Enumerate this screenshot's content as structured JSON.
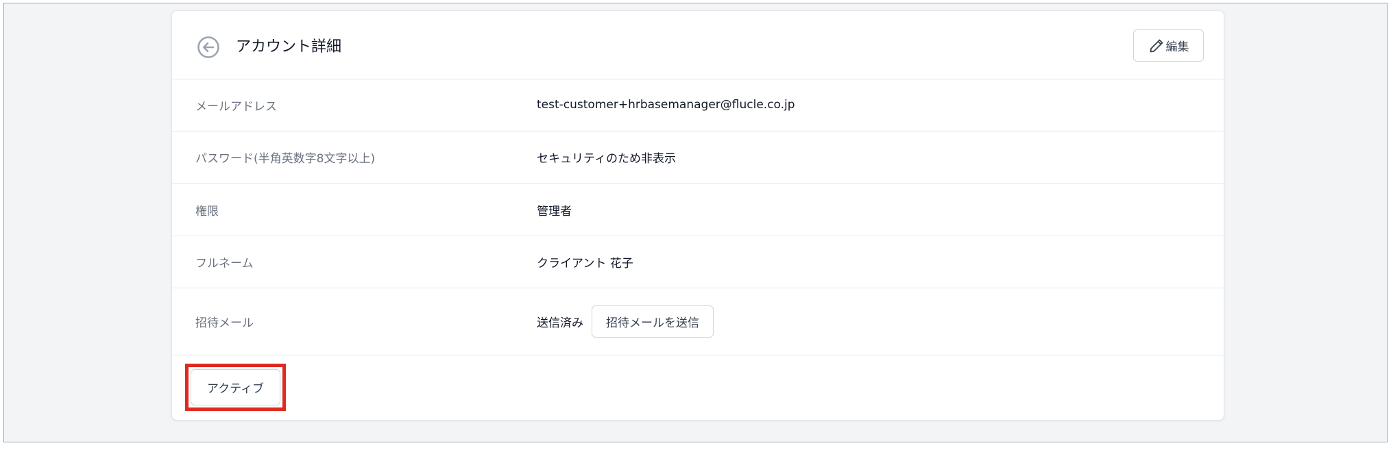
{
  "header": {
    "title": "アカウント詳細",
    "edit_label": "編集"
  },
  "rows": [
    {
      "label": "メールアドレス",
      "value": "test-customer+hrbasemanager@flucle.co.jp"
    },
    {
      "label": "パスワード(半角英数字8文字以上)",
      "value": "セキュリティのため非表示"
    },
    {
      "label": "権限",
      "value": "管理者"
    },
    {
      "label": "フルネーム",
      "value": "クライアント 花子"
    },
    {
      "label": "招待メール",
      "value": "送信済み",
      "action_label": "招待メールを送信"
    }
  ],
  "footer": {
    "status_button_label": "アクティブ"
  },
  "colors": {
    "highlight": "#e02a20",
    "border": "#e5e7eb",
    "label_text": "#6b7280"
  },
  "icons": {
    "back": "arrow-left-circle-icon",
    "edit": "pencil-icon"
  }
}
